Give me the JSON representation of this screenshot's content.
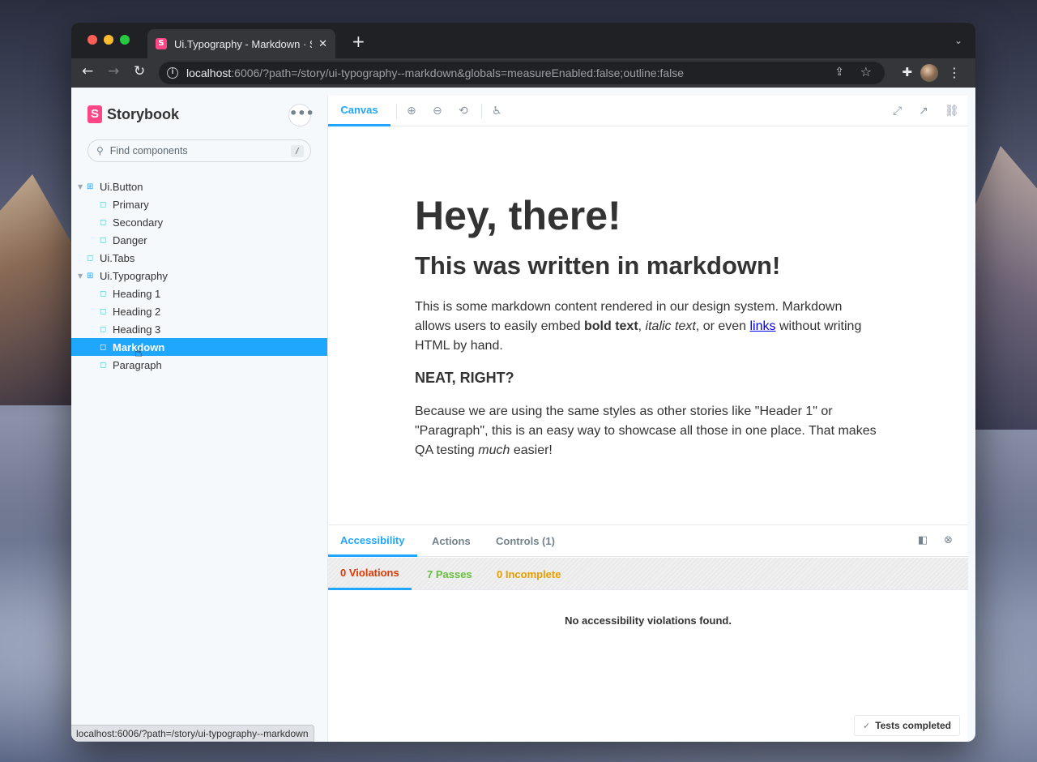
{
  "browser": {
    "tab_title": "Ui.Typography - Markdown · Storybook",
    "tab_close": "✕",
    "new_tab": "+",
    "url_host": "localhost",
    "url_path": ":6006/?path=/story/ui-typography--markdown&globals=measureEnabled:false;outline:false",
    "status_url": "localhost:6006/?path=/story/ui-typography--markdown"
  },
  "sidebar": {
    "logo_text": "Storybook",
    "logo_mark": "S",
    "menu_label": "•••",
    "search_placeholder": "Find components",
    "search_shortcut": "/",
    "tree": [
      {
        "label": "Ui.Button",
        "type": "component",
        "level": 0
      },
      {
        "label": "Primary",
        "type": "story",
        "level": 1
      },
      {
        "label": "Secondary",
        "type": "story",
        "level": 1
      },
      {
        "label": "Danger",
        "type": "story",
        "level": 1
      },
      {
        "label": "Ui.Tabs",
        "type": "story",
        "level": 0
      },
      {
        "label": "Ui.Typography",
        "type": "component",
        "level": 0
      },
      {
        "label": "Heading 1",
        "type": "story",
        "level": 1
      },
      {
        "label": "Heading 2",
        "type": "story",
        "level": 1
      },
      {
        "label": "Heading 3",
        "type": "story",
        "level": 1
      },
      {
        "label": "Markdown",
        "type": "story",
        "level": 1,
        "selected": true
      },
      {
        "label": "Paragraph",
        "type": "story",
        "level": 1
      }
    ]
  },
  "canvas": {
    "tab_label": "Canvas"
  },
  "story": {
    "h1": "Hey, there!",
    "h2": "This was written in markdown!",
    "p1_a": "This is some markdown content rendered in our design system. Markdown allows users to easily embed ",
    "p1_bold": "bold text",
    "p1_b": ", ",
    "p1_italic": "italic text",
    "p1_c": ", or even ",
    "p1_link": "links",
    "p1_d": " without writing HTML by hand.",
    "h3": "NEAT, RIGHT?",
    "p2_a": "Because we are using the same styles as other stories like \"Header 1\" or \"Paragraph\", this is an easy way to showcase all those in one place. That makes QA testing ",
    "p2_italic": "much",
    "p2_b": " easier!"
  },
  "addons": {
    "tabs": [
      "Accessibility",
      "Actions",
      "Controls (1)"
    ],
    "a11y_tabs": {
      "violations": "0 Violations",
      "passes": "7 Passes",
      "incomplete": "0 Incomplete"
    },
    "message": "No accessibility violations found.",
    "tests_status": "Tests completed"
  },
  "colors": {
    "accent": "#1ea7fd",
    "brand": "#ff4785",
    "violation": "#e03a00",
    "pass": "#66bf3c",
    "incomplete": "#e69d00"
  }
}
